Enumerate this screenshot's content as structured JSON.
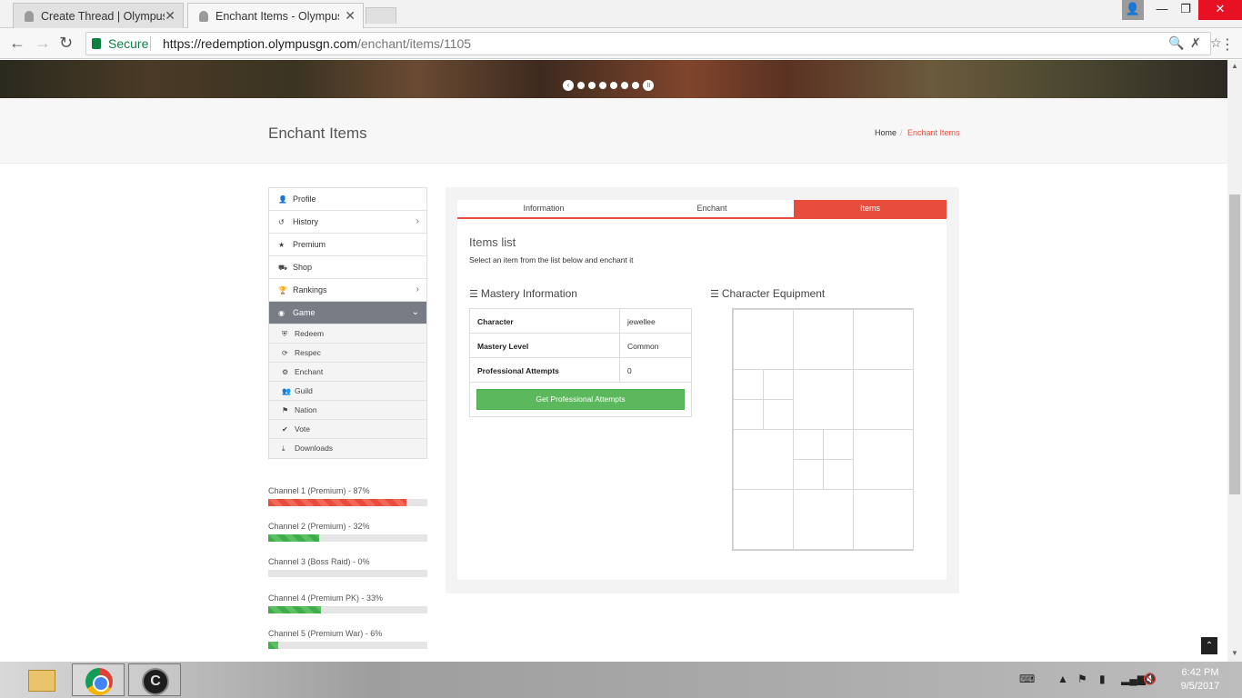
{
  "browser": {
    "tabs": [
      {
        "title": "Create Thread | Olympus",
        "close": "✕"
      },
      {
        "title": "Enchant Items - Olympus",
        "close": "✕"
      }
    ],
    "secure_label": "Secure",
    "url_host": "https://redemption.olympusgn.com",
    "url_path": "/enchant/items/1105"
  },
  "header": {
    "title": "Enchant Items",
    "breadcrumb": {
      "home": "Home",
      "separator": "/",
      "current": "Enchant Items"
    }
  },
  "sidebar": {
    "items": [
      {
        "label": "Profile",
        "icon": "user-icon",
        "glyph": "👤"
      },
      {
        "label": "History",
        "icon": "history-icon",
        "glyph": "↺",
        "chevron": "›"
      },
      {
        "label": "Premium",
        "icon": "star-icon",
        "glyph": "★"
      },
      {
        "label": "Shop",
        "icon": "cart-icon",
        "glyph": "⛟"
      },
      {
        "label": "Rankings",
        "icon": "trophy-icon",
        "glyph": "🏆",
        "chevron": "›"
      },
      {
        "label": "Game",
        "icon": "gamepad-icon",
        "glyph": "◉",
        "chevron": "⌄"
      }
    ],
    "sub_items": [
      {
        "label": "Redeem",
        "icon": "shield-icon",
        "glyph": "⛨"
      },
      {
        "label": "Respec",
        "icon": "refresh-icon",
        "glyph": "⟳"
      },
      {
        "label": "Enchant",
        "icon": "gear-icon",
        "glyph": "⚙"
      },
      {
        "label": "Guild",
        "icon": "users-icon",
        "glyph": "👥"
      },
      {
        "label": "Nation",
        "icon": "flag-icon",
        "glyph": "⚑"
      },
      {
        "label": "Vote",
        "icon": "check-icon",
        "glyph": "✔"
      },
      {
        "label": "Downloads",
        "icon": "download-icon",
        "glyph": "⤓"
      }
    ]
  },
  "channels": [
    {
      "label": "Channel 1 (Premium) - 87%",
      "percent": 87,
      "color": "#e74c3c"
    },
    {
      "label": "Channel 2 (Premium) - 32%",
      "percent": 32,
      "color": "#3fae49"
    },
    {
      "label": "Channel 3 (Boss Raid) - 0%",
      "percent": 0,
      "color": "#3fae49"
    },
    {
      "label": "Channel 4 (Premium PK) - 33%",
      "percent": 33,
      "color": "#3fae49"
    },
    {
      "label": "Channel 5 (Premium War) - 6%",
      "percent": 6,
      "color": "#3fae49"
    }
  ],
  "main": {
    "tabs": [
      "Information",
      "Enchant",
      "Items"
    ],
    "active_tab": "Items",
    "items_title": "Items list",
    "items_desc": "Select an item from the list below and enchant it",
    "mastery": {
      "heading": "Mastery Information",
      "rows": [
        {
          "key": "Character",
          "value": "jewellee"
        },
        {
          "key": "Mastery Level",
          "value": "Common"
        },
        {
          "key": "Professional Attempts",
          "value": "0"
        }
      ],
      "button": "Get Professional Attempts"
    },
    "equipment_heading": "Character Equipment"
  },
  "taskbar": {
    "time": "6:42 PM",
    "date": "9/5/2017"
  },
  "colors": {
    "accent": "#e74c3c",
    "success": "#5cb85c",
    "sidebar_active": "#777c85"
  }
}
